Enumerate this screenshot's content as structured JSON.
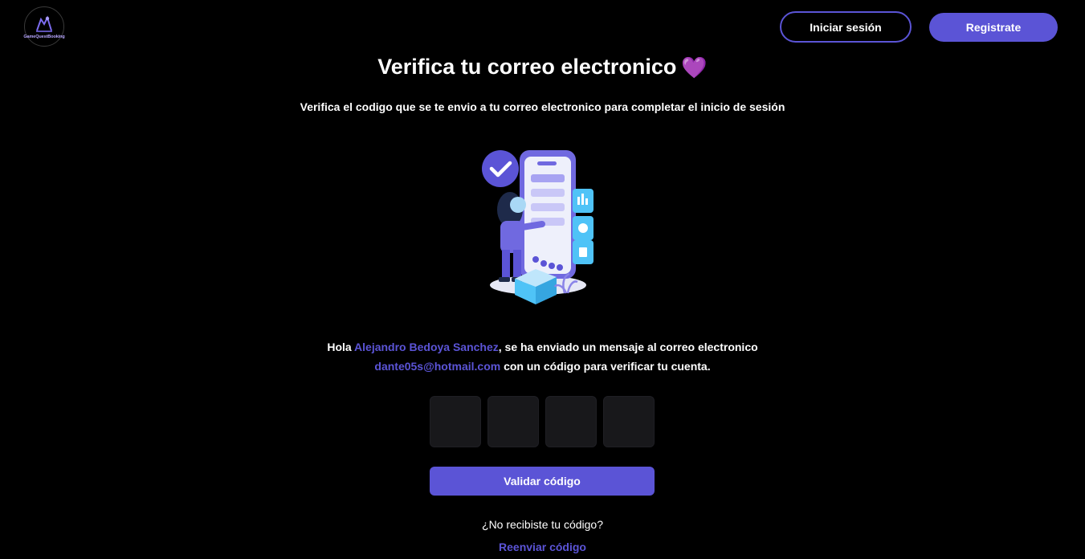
{
  "header": {
    "logo_text": "GameQuestBooking",
    "login_label": "Iniciar sesión",
    "register_label": "Registrate"
  },
  "main": {
    "title": "Verifica tu correo electronico",
    "title_emoji": "💜",
    "subtitle": "Verifica el codigo que se te envio a tu correo electronico para completar el inicio de sesión",
    "message": {
      "greeting": "Hola",
      "user_name": "Alejandro Bedoya Sanchez",
      "sent_text": ", se ha enviado un mensaje al correo electronico",
      "email": "dante05s@hotmail.com",
      "verify_text": " con un código para verificar tu cuenta."
    },
    "code_inputs": [
      "",
      "",
      "",
      ""
    ],
    "validate_label": "Validar código",
    "no_code_text": "¿No recibiste tu código?",
    "resend_label": "Reenviar código"
  },
  "colors": {
    "background": "#000000",
    "accent": "#5b54d6",
    "input_bg": "#18181b"
  },
  "icons": [
    "logo-icon",
    "verification-illustration",
    "checkmark-icon",
    "purple-heart-icon"
  ]
}
